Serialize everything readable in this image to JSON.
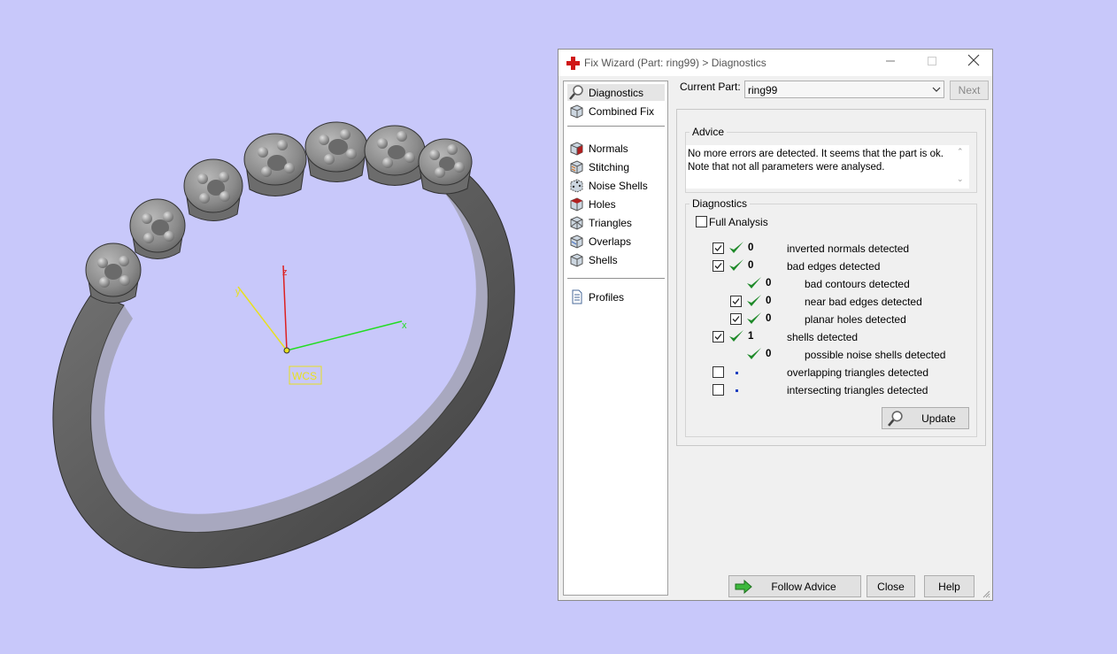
{
  "viewport": {
    "axes": {
      "x": "x",
      "y": "y",
      "z": "z",
      "origin_label": "WCS"
    }
  },
  "window": {
    "title": "Fix Wizard (Part: ring99) > Diagnostics",
    "controls": {
      "minimize": "—",
      "maximize": "☐",
      "close": "✕"
    }
  },
  "nav": {
    "items": [
      {
        "label": "Diagnostics",
        "icon": "magnifier-icon"
      },
      {
        "label": "Combined Fix",
        "icon": "cube-icon"
      },
      {
        "label": "Normals",
        "icon": "normals-cube-icon"
      },
      {
        "label": "Stitching",
        "icon": "stitching-cube-icon"
      },
      {
        "label": "Noise Shells",
        "icon": "noise-cube-icon"
      },
      {
        "label": "Holes",
        "icon": "holes-cube-icon"
      },
      {
        "label": "Triangles",
        "icon": "triangles-cube-icon"
      },
      {
        "label": "Overlaps",
        "icon": "overlaps-cube-icon"
      },
      {
        "label": "Shells",
        "icon": "shells-cube-icon"
      },
      {
        "label": "Profiles",
        "icon": "document-icon"
      }
    ],
    "selected": "Diagnostics"
  },
  "current_part": {
    "label": "Current Part:",
    "value": "ring99",
    "next_label": "Next"
  },
  "advice": {
    "title": "Advice",
    "text": "No more errors are detected. It seems that the part is ok. Note that not all parameters were analysed."
  },
  "diagnostics": {
    "title": "Diagnostics",
    "full_analysis_label": "Full Analysis",
    "full_analysis_checked": false,
    "rows": [
      {
        "checkbox": true,
        "checked": true,
        "status": "ok",
        "count": "0",
        "label": "inverted normals detected"
      },
      {
        "checkbox": true,
        "checked": true,
        "status": "ok",
        "count": "0",
        "label": "bad edges detected"
      },
      {
        "checkbox": false,
        "checked": false,
        "status": "ok",
        "count": "0",
        "label": "bad contours detected"
      },
      {
        "checkbox": true,
        "checked": true,
        "status": "ok",
        "count": "0",
        "label": "near bad edges detected"
      },
      {
        "checkbox": true,
        "checked": true,
        "status": "ok",
        "count": "0",
        "label": "planar holes detected"
      },
      {
        "checkbox": true,
        "checked": true,
        "status": "ok",
        "count": "1",
        "label": "shells detected"
      },
      {
        "checkbox": false,
        "checked": false,
        "status": "ok",
        "count": "0",
        "label": "possible noise shells detected"
      },
      {
        "checkbox": true,
        "checked": false,
        "status": "none",
        "count": "",
        "label": "overlapping triangles detected"
      },
      {
        "checkbox": true,
        "checked": false,
        "status": "none",
        "count": "",
        "label": "intersecting triangles detected"
      }
    ],
    "update_label": "Update"
  },
  "footer": {
    "follow_advice_label": "Follow Advice",
    "close_label": "Close",
    "help_label": "Help"
  },
  "colors": {
    "viewport_bg": "#c8c8fa",
    "tick_green": "#1f8a2a",
    "axis_x": "#22dd22",
    "axis_y": "#e8e020",
    "axis_z": "#dd2020"
  }
}
